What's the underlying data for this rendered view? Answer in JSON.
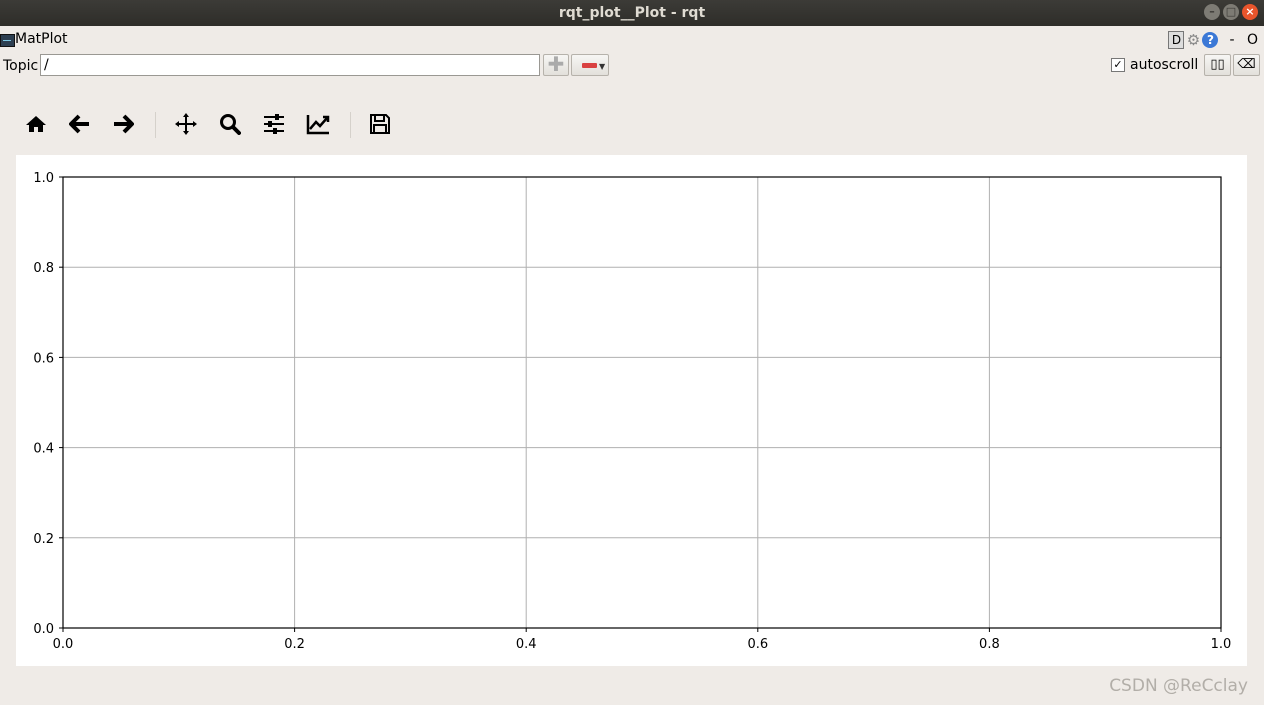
{
  "window": {
    "title": "rqt_plot__Plot - rqt"
  },
  "plugin": {
    "title": "MatPlot",
    "d_label": "D",
    "help_label": "?",
    "extra_text": "- O"
  },
  "topic": {
    "label": "Topic",
    "value": "/"
  },
  "autoscroll": {
    "label": "autoscroll",
    "checked": true,
    "check_mark": "✓"
  },
  "toolbar": {
    "items": [
      "home-icon",
      "back-arrow-icon",
      "forward-arrow-icon",
      "pan-icon",
      "zoom-icon",
      "configure-subplots-icon",
      "edit-axis-icon",
      "save-icon"
    ]
  },
  "chart_data": {
    "type": "line",
    "series": [],
    "title": "",
    "xlabel": "",
    "ylabel": "",
    "xlim": [
      0.0,
      1.0
    ],
    "ylim": [
      0.0,
      1.0
    ],
    "xticks": [
      "0.0",
      "0.2",
      "0.4",
      "0.6",
      "0.8",
      "1.0"
    ],
    "yticks": [
      "0.0",
      "0.2",
      "0.4",
      "0.6",
      "0.8",
      "1.0"
    ],
    "grid": true
  },
  "watermark": "CSDN @ReCclay"
}
